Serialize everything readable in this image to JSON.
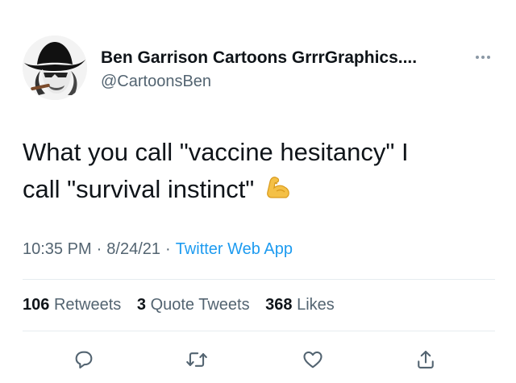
{
  "user": {
    "name": "Ben Garrison Cartoons GrrrGraphics....",
    "handle": "@CartoonsBen",
    "avatar_icon": "cowboy-hat-portrait"
  },
  "tweet": {
    "text_line1": "What you call \"vaccine hesitancy\" I",
    "text_line2": "call \"survival instinct\"",
    "emoji": "flexed-biceps-emoji",
    "time": "10:35 PM",
    "date": "8/24/21",
    "separator": "·",
    "source": "Twitter Web App"
  },
  "stats": {
    "retweets_count": "106",
    "retweets_label": "Retweets",
    "quotes_count": "3",
    "quotes_label": "Quote Tweets",
    "likes_count": "368",
    "likes_label": "Likes"
  },
  "actions": [
    "reply-icon",
    "retweet-icon",
    "like-icon",
    "share-icon"
  ],
  "colors": {
    "text": "#0f1419",
    "secondary": "#536471",
    "link": "#1d9bf0",
    "divider": "#e6ecf0"
  }
}
